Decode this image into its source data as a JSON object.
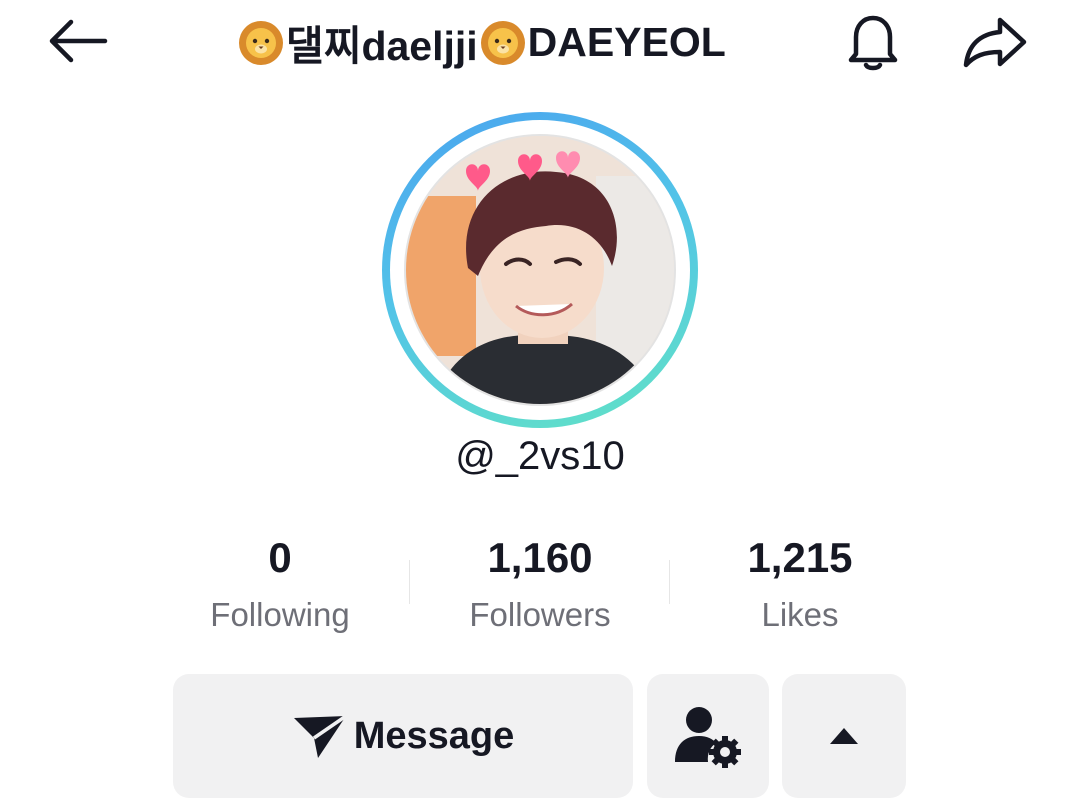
{
  "header": {
    "title_part1": "댈찌daeljji",
    "title_part2": "DAEYEOL",
    "left_emoji_icon": "lion-face-icon",
    "middle_emoji_icon": "lion-face-icon",
    "back_icon": "arrow-left-icon",
    "bell_icon": "bell-icon",
    "share_icon": "share-arrow-icon"
  },
  "profile": {
    "username": "@_2vs10",
    "avatar_ring_colors": [
      "#4aa3ef",
      "#62e3c4"
    ]
  },
  "stats": [
    {
      "value": "0",
      "label": "Following"
    },
    {
      "value": "1,160",
      "label": "Followers"
    },
    {
      "value": "1,215",
      "label": "Likes"
    }
  ],
  "actions": {
    "message_label": "Message",
    "message_icon": "send-icon",
    "friends_icon": "person-gear-icon",
    "more_icon": "caret-up-icon"
  }
}
